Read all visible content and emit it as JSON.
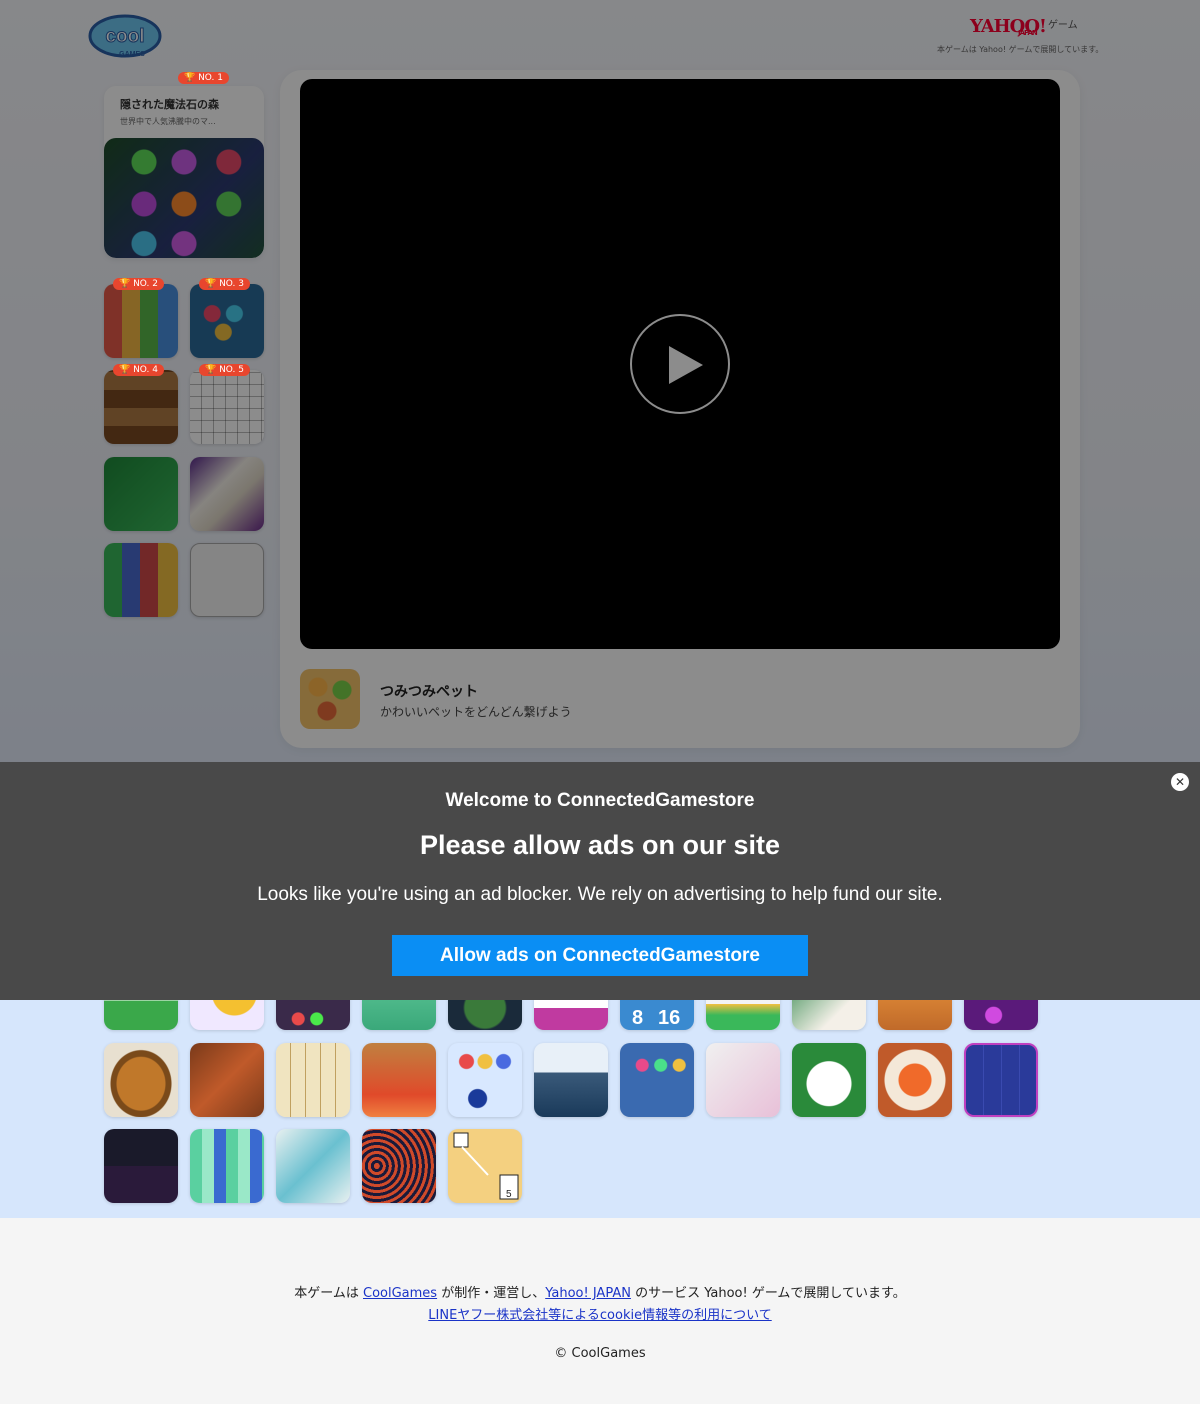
{
  "header": {
    "logo_text": "COOL GAMES",
    "yahoo_logo": "YAHOO!",
    "yahoo_japan": "JAPAN",
    "yahoo_game": "ゲーム",
    "yahoo_note": "本ゲームは Yahoo! ゲームで展開しています。"
  },
  "sidebar": {
    "featured": {
      "rank": "🏆 NO. 1",
      "title": "隠された魔法石の森",
      "desc": "世界中で人気沸騰中のマ..."
    },
    "ranks": [
      "🏆 NO. 2",
      "🏆 NO. 3",
      "🏆 NO. 4",
      "🏆 NO. 5"
    ]
  },
  "player": {
    "title": "つみつみペット",
    "desc": "かわいいペットをどんどん繋げよう",
    "play_icon": "play-icon"
  },
  "banner": {
    "welcome": "Welcome to ConnectedGamestore",
    "headline": "Please allow ads on our site",
    "message": "Looks like you're using an ad blocker. We rely on advertising to help fund our site.",
    "allow_button": "Allow ads on ConnectedGamestore",
    "close_glyph": "✕"
  },
  "footer": {
    "prefix": "本ゲームは ",
    "coolgames_link": "CoolGames",
    "middle": " が制作・運営し、",
    "yahoo_link": "Yahoo! JAPAN",
    "suffix": " のサービス Yahoo! ゲームで展開しています。",
    "cookie_link": "LINEヤフー株式会社等によるcookie情報等の利用について",
    "copyright": "© CoolGames"
  },
  "colors": {
    "banner_bg": "#494949",
    "allow_button": "#0a8ef4",
    "grid_bg": "#d6e6fc",
    "rank_badge": "#e8462e",
    "link": "#1a33c7"
  }
}
